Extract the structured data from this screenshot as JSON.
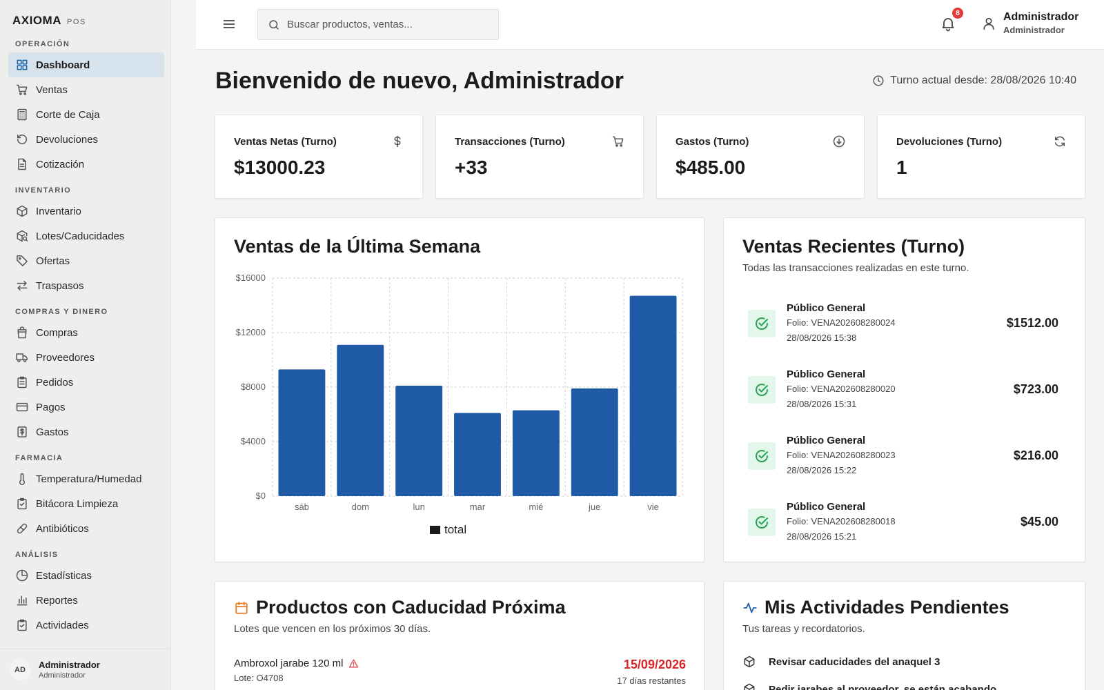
{
  "app": {
    "brand": "AXIOMA",
    "brand_sub": "POS"
  },
  "sidebar": {
    "sections": [
      {
        "title": "OPERACIÓN",
        "items": [
          {
            "label": "Dashboard",
            "icon": "dashboard-icon",
            "active": true
          },
          {
            "label": "Ventas",
            "icon": "cart-icon"
          },
          {
            "label": "Corte de Caja",
            "icon": "calculator-icon"
          },
          {
            "label": "Devoluciones",
            "icon": "undo-icon"
          },
          {
            "label": "Cotización",
            "icon": "document-icon"
          }
        ]
      },
      {
        "title": "INVENTARIO",
        "items": [
          {
            "label": "Inventario",
            "icon": "box-icon"
          },
          {
            "label": "Lotes/Caducidades",
            "icon": "box-search-icon"
          },
          {
            "label": "Ofertas",
            "icon": "tag-icon"
          },
          {
            "label": "Traspasos",
            "icon": "transfer-icon"
          }
        ]
      },
      {
        "title": "COMPRAS Y DINERO",
        "items": [
          {
            "label": "Compras",
            "icon": "bag-icon"
          },
          {
            "label": "Proveedores",
            "icon": "truck-icon"
          },
          {
            "label": "Pedidos",
            "icon": "clipboard-icon"
          },
          {
            "label": "Pagos",
            "icon": "credit-card-icon"
          },
          {
            "label": "Gastos",
            "icon": "receipt-icon"
          }
        ]
      },
      {
        "title": "FARMACIA",
        "items": [
          {
            "label": "Temperatura/Humedad",
            "icon": "thermometer-icon"
          },
          {
            "label": "Bitácora Limpieza",
            "icon": "clipboard-check-icon"
          },
          {
            "label": "Antibióticos",
            "icon": "pill-icon"
          }
        ]
      },
      {
        "title": "ANÁLISIS",
        "items": [
          {
            "label": "Estadísticas",
            "icon": "pie-chart-icon"
          },
          {
            "label": "Reportes",
            "icon": "bar-chart-icon"
          },
          {
            "label": "Actividades",
            "icon": "clipboard-check-icon"
          }
        ]
      }
    ],
    "user": {
      "initials": "AD",
      "name": "Administrador",
      "role": "Administrador"
    }
  },
  "header": {
    "search_placeholder": "Buscar productos, ventas...",
    "notifications_count": "8",
    "user_name": "Administrador",
    "user_role": "Administrador"
  },
  "main": {
    "welcome": "Bienvenido de nuevo, Administrador",
    "shift": "Turno actual desde: 28/08/2026 10:40",
    "stats": [
      {
        "label": "Ventas Netas (Turno)",
        "value": "$13000.23",
        "icon": "dollar-icon"
      },
      {
        "label": "Transacciones (Turno)",
        "value": "+33",
        "icon": "cart-icon"
      },
      {
        "label": "Gastos (Turno)",
        "value": "$485.00",
        "icon": "arrow-down-circle-icon"
      },
      {
        "label": "Devoluciones (Turno)",
        "value": "1",
        "icon": "refresh-icon"
      }
    ],
    "chart_title": "Ventas de la Última Semana",
    "recent": {
      "title": "Ventas Recientes (Turno)",
      "subtitle": "Todas las transacciones realizadas en este turno.",
      "items": [
        {
          "customer": "Público General",
          "folio": "Folio: VENA202608280024",
          "date": "28/08/2026 15:38",
          "amount": "$1512.00"
        },
        {
          "customer": "Público General",
          "folio": "Folio: VENA202608280020",
          "date": "28/08/2026 15:31",
          "amount": "$723.00"
        },
        {
          "customer": "Público General",
          "folio": "Folio: VENA202608280023",
          "date": "28/08/2026 15:22",
          "amount": "$216.00"
        },
        {
          "customer": "Público General",
          "folio": "Folio: VENA202608280018",
          "date": "28/08/2026 15:21",
          "amount": "$45.00"
        }
      ]
    },
    "expiry": {
      "title": "Productos con Caducidad Próxima",
      "subtitle": "Lotes que vencen en los próximos 30 días.",
      "items": [
        {
          "name": "Ambroxol jarabe 120 ml",
          "lot": "Lote: O4708",
          "date": "15/09/2026",
          "days": "17 días restantes"
        }
      ]
    },
    "tasks": {
      "title": "Mis Actividades Pendientes",
      "subtitle": "Tus tareas y recordatorios.",
      "items": [
        {
          "label": "Revisar caducidades del anaquel 3"
        },
        {
          "label": "Pedir jarabes al proveedor, se están acabando"
        }
      ]
    }
  },
  "colors": {
    "accent": "#1e5fa8",
    "bar": "#1e5aa5",
    "danger": "#d8262b",
    "success": "#22a352"
  },
  "chart_data": {
    "type": "bar",
    "categories": [
      "sáb",
      "dom",
      "lun",
      "mar",
      "mié",
      "jue",
      "vie"
    ],
    "series": [
      {
        "name": "total",
        "values": [
          9300,
          11100,
          8100,
          6100,
          6300,
          7900,
          14700
        ]
      }
    ],
    "yticks": [
      "$0",
      "$4000",
      "$8000",
      "$12000",
      "$16000"
    ],
    "ylim": [
      0,
      16000
    ],
    "grid": true,
    "legend": "bottom-center"
  }
}
